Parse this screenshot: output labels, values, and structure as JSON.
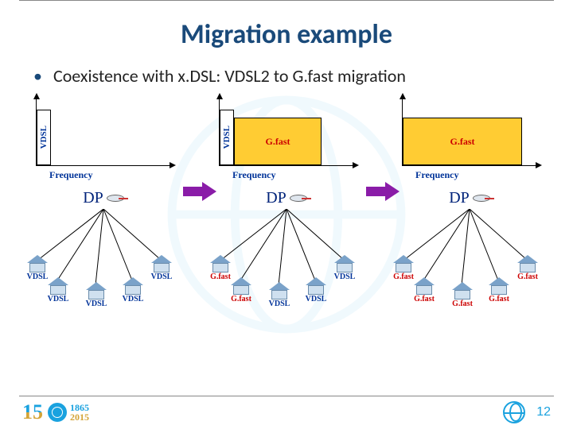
{
  "title": "Migration example",
  "bullet": "Coexistence with x.DSL: VDSL2 to G.fast migration",
  "freq_label": "Frequency",
  "vdsl": "VDSL",
  "gfast": "G.fast",
  "dp": "DP",
  "stages": [
    {
      "houses": [
        "VDSL",
        "VDSL",
        "VDSL",
        "VDSL",
        "VDSL"
      ],
      "vdsl_band": true,
      "gfast_band": false
    },
    {
      "houses": [
        "G.fast",
        "G.fast",
        "VDSL",
        "VDSL",
        "VDSL"
      ],
      "vdsl_band": true,
      "gfast_band": true
    },
    {
      "houses": [
        "G.fast",
        "G.fast",
        "G.fast",
        "G.fast",
        "G.fast"
      ],
      "vdsl_band": false,
      "gfast_band": true
    }
  ],
  "footer": {
    "num": "15",
    "y1": "1865",
    "y2": "2015",
    "page": "12"
  }
}
